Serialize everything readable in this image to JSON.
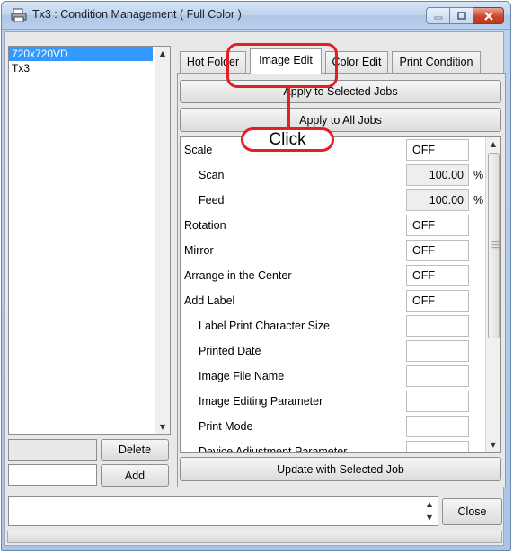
{
  "window": {
    "title": "Tx3 : Condition Management ( Full Color )"
  },
  "icons": {
    "app": "app-printer-icon",
    "minimize": "minimize-icon",
    "maximize": "maximize-icon",
    "close": "close-icon"
  },
  "job_list": {
    "items": [
      "720x720VD",
      "Tx3"
    ],
    "selected": 0
  },
  "left_buttons": {
    "delete": "Delete",
    "add": "Add"
  },
  "tabs": [
    "Hot Folder",
    "Image Edit",
    "Color Edit",
    "Print Condition"
  ],
  "active_tab": "Image Edit",
  "actions": {
    "apply_selected": "Apply to Selected Jobs",
    "apply_all": "Apply to All Jobs",
    "update": "Update with Selected Job"
  },
  "callout": "Click",
  "properties": [
    {
      "label": "Scale",
      "value": "OFF"
    },
    {
      "label": "Scan",
      "value": "100.00",
      "unit": "%"
    },
    {
      "label": "Feed",
      "value": "100.00",
      "unit": "%"
    },
    {
      "label": "Rotation",
      "value": "OFF"
    },
    {
      "label": "Mirror",
      "value": "OFF"
    },
    {
      "label": "Arrange in the Center",
      "value": "OFF"
    },
    {
      "label": "Add Label",
      "value": "OFF"
    },
    {
      "label": "Label Print Character Size",
      "value": ""
    },
    {
      "label": "Printed Date",
      "value": ""
    },
    {
      "label": "Image File Name",
      "value": ""
    },
    {
      "label": "Image Editing Parameter",
      "value": ""
    },
    {
      "label": "Print Mode",
      "value": ""
    },
    {
      "label": "Device Adjustment Parameter",
      "value": ""
    }
  ],
  "bottom": {
    "close": "Close"
  },
  "colors": {
    "highlight": "#e31e24",
    "selection": "#3399ff"
  }
}
